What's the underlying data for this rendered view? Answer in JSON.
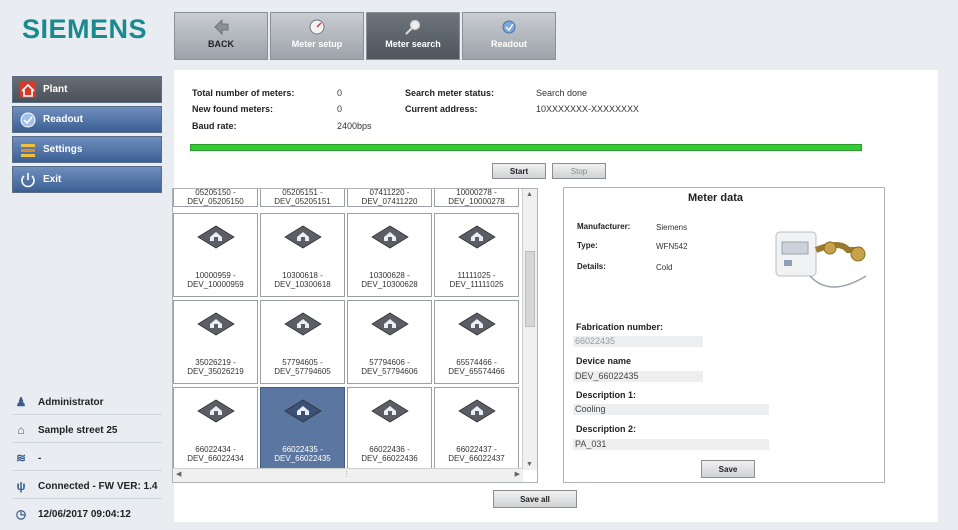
{
  "brand": "SIEMENS",
  "toolbar": {
    "back": "BACK",
    "meter_setup": "Meter setup",
    "meter_search": "Meter search",
    "readout": "Readout"
  },
  "sidebar": {
    "plant": "Plant",
    "readout": "Readout",
    "settings": "Settings",
    "exit": "Exit"
  },
  "status": {
    "user": "Administrator",
    "address": "Sample street 25",
    "signal": "-",
    "connection": "Connected - FW VER: 1.4",
    "datetime": "12/06/2017 09:04:12"
  },
  "search_info": {
    "total_label": "Total number of meters:",
    "total_value": "0",
    "new_label": "New found meters:",
    "new_value": "0",
    "baud_label": "Baud rate:",
    "baud_value": "2400bps",
    "status_label": "Search meter status:",
    "status_value": "Search done",
    "address_label": "Current address:",
    "address_value": "10XXXXXXX-XXXXXXXX",
    "progress": 1.0
  },
  "buttons": {
    "start": "Start",
    "stop": "Stop",
    "save": "Save",
    "save_all": "Save all"
  },
  "meters_top_row": [
    {
      "id": "05205150 -",
      "name": "DEV_05205150"
    },
    {
      "id": "05205151 -",
      "name": "DEV_05205151"
    },
    {
      "id": "07411220 -",
      "name": "DEV_07411220"
    },
    {
      "id": "10000278 -",
      "name": "DEV_10000278"
    }
  ],
  "meters": [
    {
      "id": "10000959 -",
      "name": "DEV_10000959"
    },
    {
      "id": "10300618 -",
      "name": "DEV_10300618"
    },
    {
      "id": "10300628 -",
      "name": "DEV_10300628"
    },
    {
      "id": "11111025 -",
      "name": "DEV_11111025"
    },
    {
      "id": "35026219 -",
      "name": "DEV_35026219"
    },
    {
      "id": "57794605 -",
      "name": "DEV_57794605"
    },
    {
      "id": "57794606 -",
      "name": "DEV_57794606"
    },
    {
      "id": "65574466 -",
      "name": "DEV_65574466"
    },
    {
      "id": "66022434 -",
      "name": "DEV_66022434"
    },
    {
      "id": "66022435 -",
      "name": "DEV_66022435",
      "selected": true
    },
    {
      "id": "66022436 -",
      "name": "DEV_66022436"
    },
    {
      "id": "66022437 -",
      "name": "DEV_66022437"
    }
  ],
  "meter_data": {
    "title": "Meter data",
    "manufacturer_label": "Manufacturer:",
    "manufacturer_value": "Siemens",
    "type_label": "Type:",
    "type_value": "WFN542",
    "details_label": "Details:",
    "details_value": "Cold",
    "fabrication_label": "Fabrication number:",
    "fabrication_value": "66022435",
    "device_name_label": "Device name",
    "device_name_value": "DEV_66022435",
    "desc1_label": "Description 1:",
    "desc1_value": "Cooling",
    "desc2_label": "Description 2:",
    "desc2_value": "PA_031"
  },
  "colors": {
    "brand": "#1a8a8f",
    "progress": "#33cc33",
    "selected_tile": "#5b76a0"
  }
}
